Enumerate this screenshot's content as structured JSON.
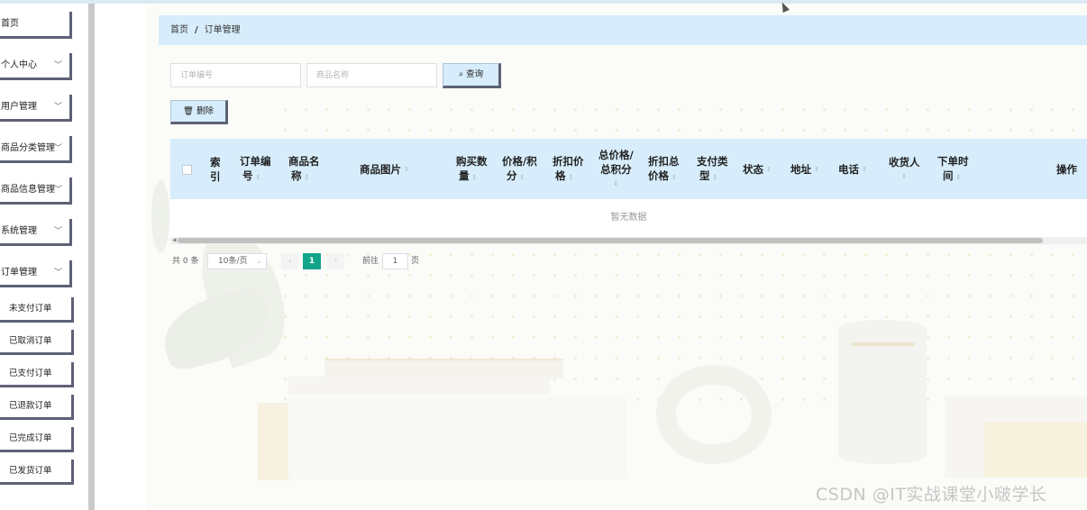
{
  "sidebar": {
    "items": [
      {
        "label": "首页"
      },
      {
        "label": "个人中心",
        "chevron": "﹀"
      },
      {
        "label": "用户管理",
        "chevron": "﹀"
      },
      {
        "label": "商品分类管理",
        "chevron": "﹀"
      },
      {
        "label": "商品信息管理",
        "chevron": "﹀"
      },
      {
        "label": "系统管理",
        "chevron": "﹀"
      },
      {
        "label": "订单管理",
        "chevron": "﹀"
      }
    ],
    "sub_items": [
      {
        "label": "未支付订单"
      },
      {
        "label": "已取消订单"
      },
      {
        "label": "已支付订单"
      },
      {
        "label": "已退款订单"
      },
      {
        "label": "已完成订单"
      },
      {
        "label": "已发货订单"
      }
    ]
  },
  "breadcrumb": {
    "home": "首页",
    "sep": "/",
    "current": "订单管理"
  },
  "search": {
    "order_no_placeholder": "订单编号",
    "product_name_placeholder": "商品名称",
    "query_label": "查询"
  },
  "toolbar": {
    "delete_label": "删除"
  },
  "table": {
    "columns": [
      {
        "l1": "索",
        "l2": "引",
        "sort": false
      },
      {
        "l1": "订单编",
        "l2": "号",
        "sort": true
      },
      {
        "l1": "商品名",
        "l2": "称",
        "sort": true
      },
      {
        "l1": "商品图片",
        "l2": "",
        "sort": true,
        "inline": true
      },
      {
        "l1": "购买数",
        "l2": "量",
        "sort": true
      },
      {
        "l1": "价格/积",
        "l2": "分",
        "sort": true
      },
      {
        "l1": "折扣价",
        "l2": "格",
        "sort": true
      },
      {
        "l1": "总价格/",
        "l2": "总积分",
        "sort": true,
        "sort_below": true
      },
      {
        "l1": "折扣总",
        "l2": "价格",
        "sort": true
      },
      {
        "l1": "支付类",
        "l2": "型",
        "sort": true
      },
      {
        "l1": "状态",
        "l2": "",
        "sort": true,
        "inline": true
      },
      {
        "l1": "地址",
        "l2": "",
        "sort": true,
        "inline": true
      },
      {
        "l1": "电话",
        "l2": "",
        "sort": true,
        "inline": true
      },
      {
        "l1": "收货人",
        "l2": "",
        "sort": true,
        "sort_below": true
      },
      {
        "l1": "下单时",
        "l2": "间",
        "sort": true
      },
      {
        "l1": "操作",
        "l2": "",
        "sort": false
      }
    ],
    "empty_text": "暂无数据"
  },
  "pagination": {
    "total": "共 0 条",
    "page_size": "10条/页",
    "current_page": "1",
    "goto_label": "前往",
    "goto_value": "1",
    "page_suffix": "页",
    "prev": "‹",
    "next": "›"
  },
  "watermark": "CSDN @IT实战课堂小啵学长"
}
